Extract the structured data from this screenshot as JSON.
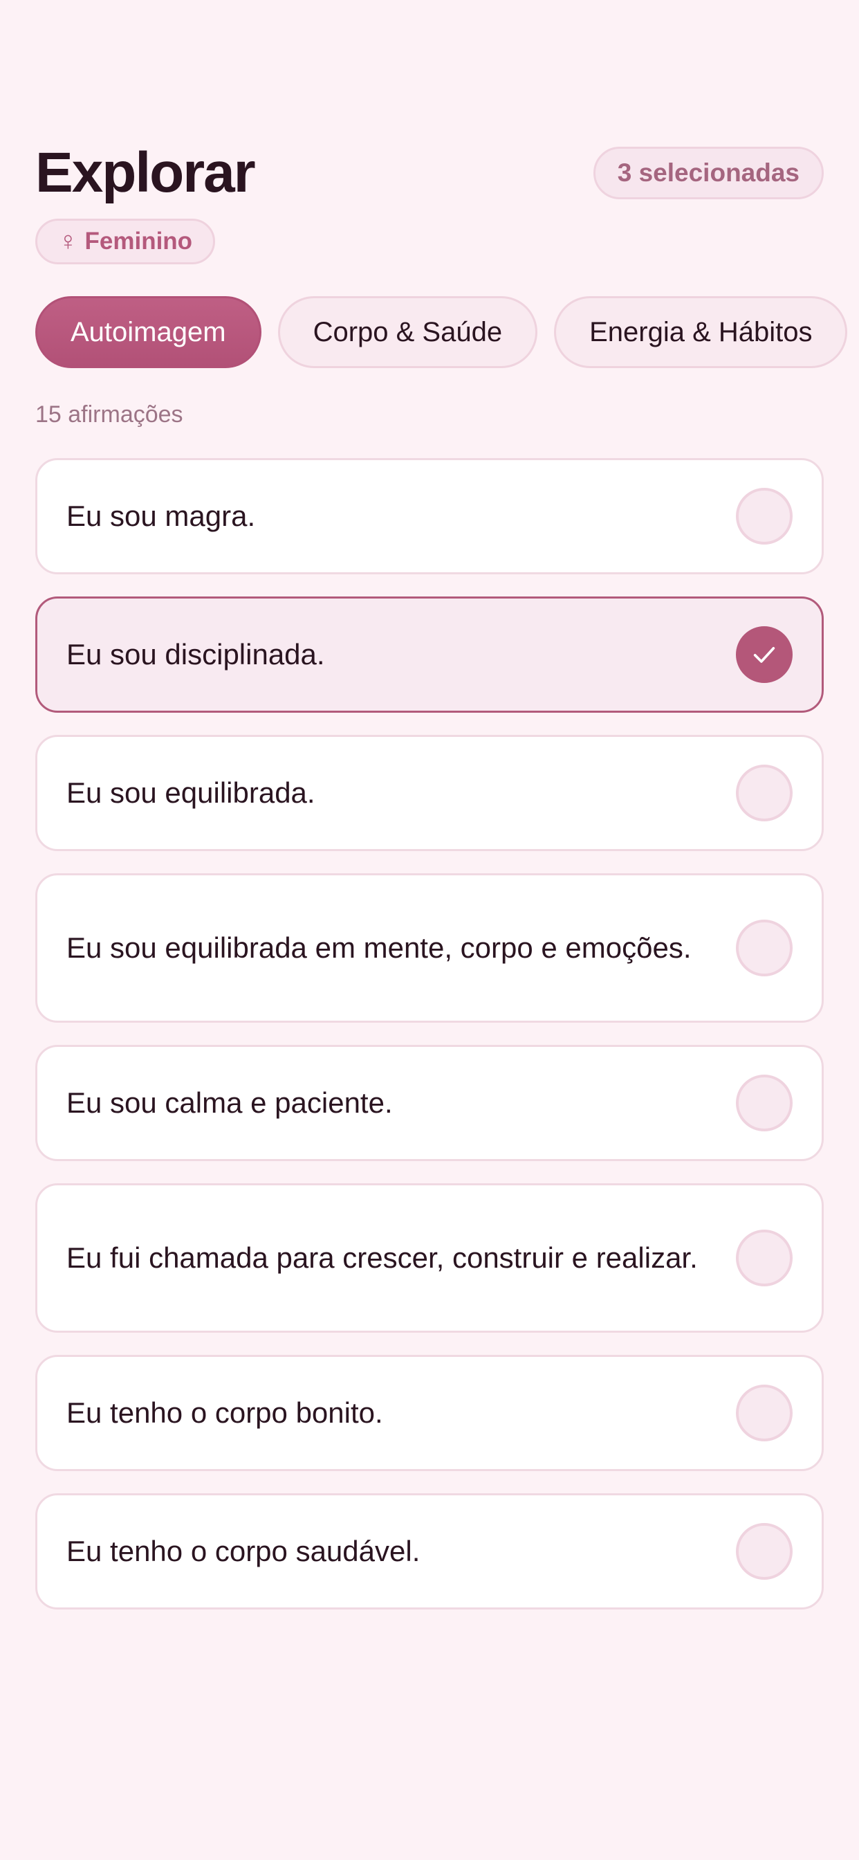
{
  "header": {
    "title": "Explorar",
    "selected_count": "3 selecionadas"
  },
  "gender": {
    "icon": "female-icon",
    "icon_glyph": "♀",
    "label": "Feminino"
  },
  "tabs": [
    {
      "label": "Autoimagem",
      "active": true
    },
    {
      "label": "Corpo & Saúde",
      "active": false
    },
    {
      "label": "Energia & Hábitos",
      "active": false
    }
  ],
  "count_text": "15 afirmações",
  "affirmations": [
    {
      "text": "Eu sou magra.",
      "selected": false
    },
    {
      "text": "Eu sou disciplinada.",
      "selected": true
    },
    {
      "text": "Eu sou equilibrada.",
      "selected": false
    },
    {
      "text": "Eu sou equilibrada em mente, corpo e emoções.",
      "selected": false
    },
    {
      "text": "Eu sou calma e paciente.",
      "selected": false
    },
    {
      "text": "Eu fui chamada para crescer, construir e realizar.",
      "selected": false
    },
    {
      "text": "Eu tenho o corpo bonito.",
      "selected": false
    },
    {
      "text": "Eu tenho o corpo saudável.",
      "selected": false
    }
  ],
  "colors": {
    "accent": "#b45779",
    "background": "#fdf2f6",
    "text": "#2a1420",
    "muted": "#9c7486"
  }
}
